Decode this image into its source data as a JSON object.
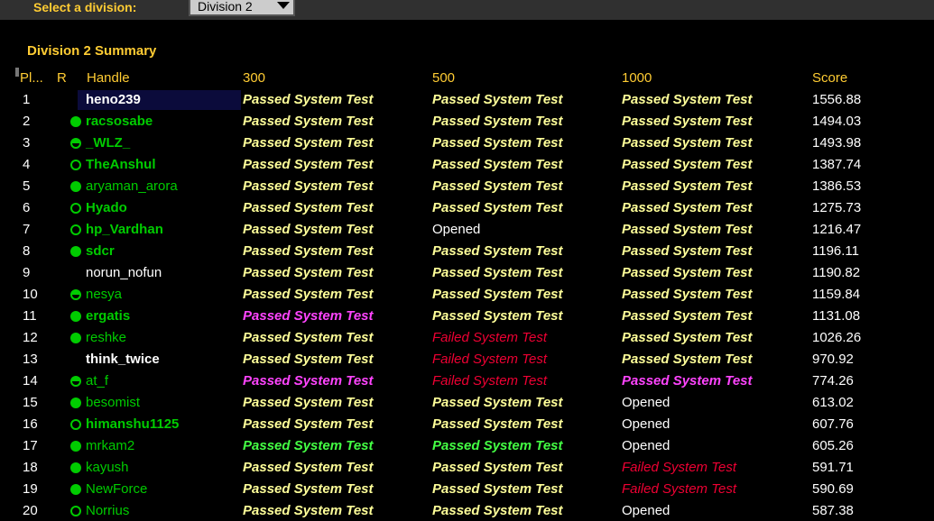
{
  "header": {
    "select_label": "Select a division:",
    "division_value": "Division 2"
  },
  "summary_title": "Division 2 Summary",
  "columns": {
    "place": "Pl...",
    "rank": "R",
    "handle": "Handle",
    "p300": "300",
    "p500": "500",
    "p1000": "1000",
    "score": "Score"
  },
  "colors": {
    "accent": "#ffcc33",
    "green_handle": "#00cc00",
    "passed": "#ffff99",
    "passed_magenta": "#ff44ff",
    "passed_green": "#44ff44",
    "failed": "#ee0033"
  },
  "rows": [
    {
      "place": "1",
      "handle": "heno239",
      "p300": "Passed System Test",
      "p500": "Passed System Test",
      "p1000": "Passed System Test",
      "score": "1556.88"
    },
    {
      "place": "2",
      "handle": "racsosabe",
      "p300": "Passed System Test",
      "p500": "Passed System Test",
      "p1000": "Passed System Test",
      "score": "1494.03"
    },
    {
      "place": "3",
      "handle": "_WLZ_",
      "p300": "Passed System Test",
      "p500": "Passed System Test",
      "p1000": "Passed System Test",
      "score": "1493.98"
    },
    {
      "place": "4",
      "handle": "TheAnshul",
      "p300": "Passed System Test",
      "p500": "Passed System Test",
      "p1000": "Passed System Test",
      "score": "1387.74"
    },
    {
      "place": "5",
      "handle": "aryaman_arora",
      "p300": "Passed System Test",
      "p500": "Passed System Test",
      "p1000": "Passed System Test",
      "score": "1386.53"
    },
    {
      "place": "6",
      "handle": "Hyado",
      "p300": "Passed System Test",
      "p500": "Passed System Test",
      "p1000": "Passed System Test",
      "score": "1275.73"
    },
    {
      "place": "7",
      "handle": "hp_Vardhan",
      "p300": "Passed System Test",
      "p500": "Opened",
      "p1000": "Passed System Test",
      "score": "1216.47"
    },
    {
      "place": "8",
      "handle": "sdcr",
      "p300": "Passed System Test",
      "p500": "Passed System Test",
      "p1000": "Passed System Test",
      "score": "1196.11"
    },
    {
      "place": "9",
      "handle": "norun_nofun",
      "p300": "Passed System Test",
      "p500": "Passed System Test",
      "p1000": "Passed System Test",
      "score": "1190.82"
    },
    {
      "place": "10",
      "handle": "nesya",
      "p300": "Passed System Test",
      "p500": "Passed System Test",
      "p1000": "Passed System Test",
      "score": "1159.84"
    },
    {
      "place": "11",
      "handle": "ergatis",
      "p300": "Passed System Test",
      "p500": "Passed System Test",
      "p1000": "Passed System Test",
      "score": "1131.08"
    },
    {
      "place": "12",
      "handle": "reshke",
      "p300": "Passed System Test",
      "p500": "Failed System Test",
      "p1000": "Passed System Test",
      "score": "1026.26"
    },
    {
      "place": "13",
      "handle": "think_twice",
      "p300": "Passed System Test",
      "p500": "Failed System Test",
      "p1000": "Passed System Test",
      "score": "970.92"
    },
    {
      "place": "14",
      "handle": "at_f",
      "p300": "Passed System Test",
      "p500": "Failed System Test",
      "p1000": "Passed System Test",
      "score": "774.26"
    },
    {
      "place": "15",
      "handle": "besomist",
      "p300": "Passed System Test",
      "p500": "Passed System Test",
      "p1000": "Opened",
      "score": "613.02"
    },
    {
      "place": "16",
      "handle": "himanshu1125",
      "p300": "Passed System Test",
      "p500": "Passed System Test",
      "p1000": "Opened",
      "score": "607.76"
    },
    {
      "place": "17",
      "handle": "mrkam2",
      "p300": "Passed System Test",
      "p500": "Passed System Test",
      "p1000": "Opened",
      "score": "605.26"
    },
    {
      "place": "18",
      "handle": "kayush",
      "p300": "Passed System Test",
      "p500": "Passed System Test",
      "p1000": "Failed System Test",
      "score": "591.71"
    },
    {
      "place": "19",
      "handle": "NewForce",
      "p300": "Passed System Test",
      "p500": "Passed System Test",
      "p1000": "Failed System Test",
      "score": "590.69"
    },
    {
      "place": "20",
      "handle": "Norrius",
      "p300": "Passed System Test",
      "p500": "Passed System Test",
      "p1000": "Opened",
      "score": "587.38"
    }
  ]
}
